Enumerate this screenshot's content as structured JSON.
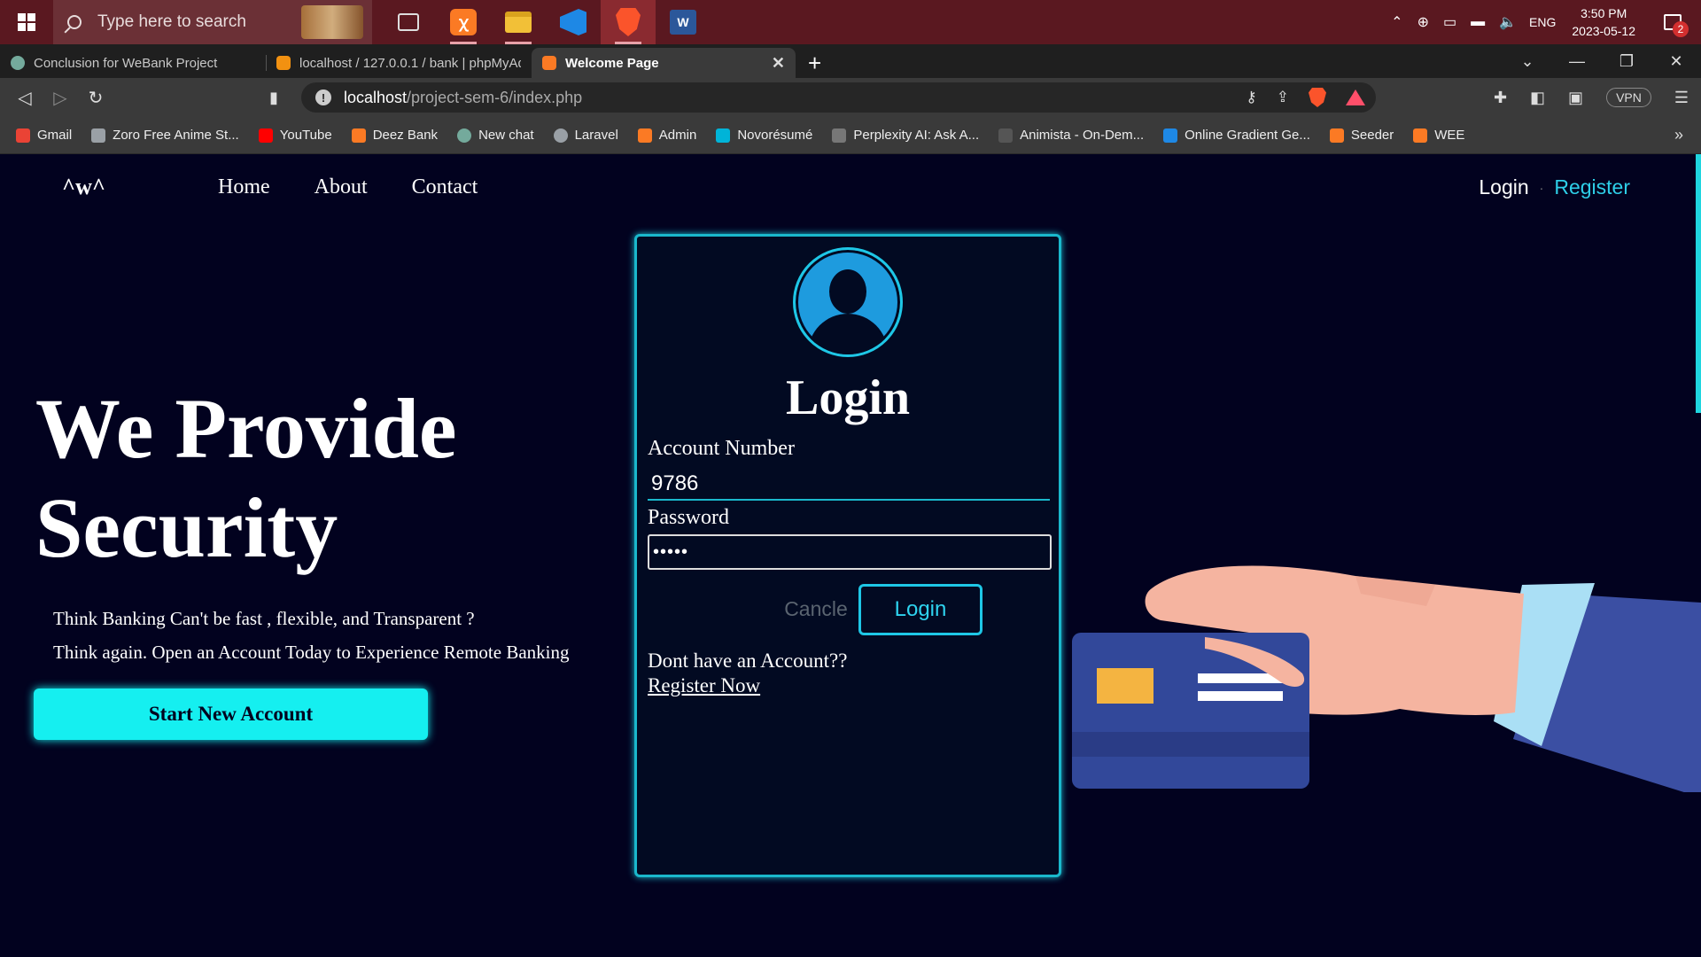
{
  "taskbar": {
    "search_placeholder": "Type here to search",
    "tray": {
      "language": "ENG",
      "time": "3:50 PM",
      "date": "2023-05-12",
      "notifications": "2"
    },
    "apps": [
      "task-view-icon",
      "xampp-icon",
      "file-explorer-icon",
      "vscode-icon",
      "brave-icon",
      "word-icon"
    ]
  },
  "browser": {
    "tabs": [
      {
        "title": "Conclusion for WeBank Project",
        "icon": "chatgpt-icon"
      },
      {
        "title": "localhost / 127.0.0.1 / bank | phpMyAdmin",
        "icon": "phpmyadmin-icon"
      },
      {
        "title": "Welcome Page",
        "icon": "xampp-icon",
        "active": true
      }
    ],
    "new_tab": "+",
    "address": {
      "host": "localhost",
      "path": "/project-sem-6/index.php"
    },
    "vpn": "VPN",
    "bookmarks": [
      {
        "label": "Gmail",
        "color": "#ea4335"
      },
      {
        "label": "Zoro Free Anime St...",
        "color": "#9aa0a6"
      },
      {
        "label": "YouTube",
        "color": "#ff0000"
      },
      {
        "label": "Deez Bank",
        "color": "#fb7a24"
      },
      {
        "label": "New chat",
        "color": "#74aa9c"
      },
      {
        "label": "Laravel",
        "color": "#9aa0a6"
      },
      {
        "label": "Admin",
        "color": "#fb7a24"
      },
      {
        "label": "Novorésumé",
        "color": "#00b4d8"
      },
      {
        "label": "Perplexity AI: Ask A...",
        "color": "#bbbbbb"
      },
      {
        "label": "Animista - On-Dem...",
        "color": "#bbbbbb"
      },
      {
        "label": "Online Gradient Ge...",
        "color": "#1e88e5"
      },
      {
        "label": "Seeder",
        "color": "#fb7a24"
      },
      {
        "label": "WEE",
        "color": "#fb7a24"
      }
    ],
    "bookmarks_more": "»"
  },
  "site": {
    "logo": "^w^",
    "nav": {
      "home": "Home",
      "about": "About",
      "contact": "Contact"
    },
    "auth": {
      "login": "Login",
      "separator": "·",
      "register": "Register"
    },
    "hero": {
      "title_line1": "We Provide",
      "title_line2": "Security",
      "text_line1": "Think Banking Can't be fast , flexible, and Transparent ?",
      "text_line2": "Think again. Open an Account Today to Experience Remote Banking",
      "cta": "Start New Account"
    },
    "login_form": {
      "title": "Login",
      "account_label": "Account Number",
      "account_value": "9786",
      "password_label": "Password",
      "password_value": "•••••",
      "cancel": "Cancle",
      "submit": "Login",
      "no_account": "Dont have an Account??",
      "register_link": "Register Now"
    },
    "colors": {
      "background": "#02021f",
      "accent": "#15eff0",
      "card_border": "#1ab8cc",
      "card_face": "#32489a"
    }
  }
}
